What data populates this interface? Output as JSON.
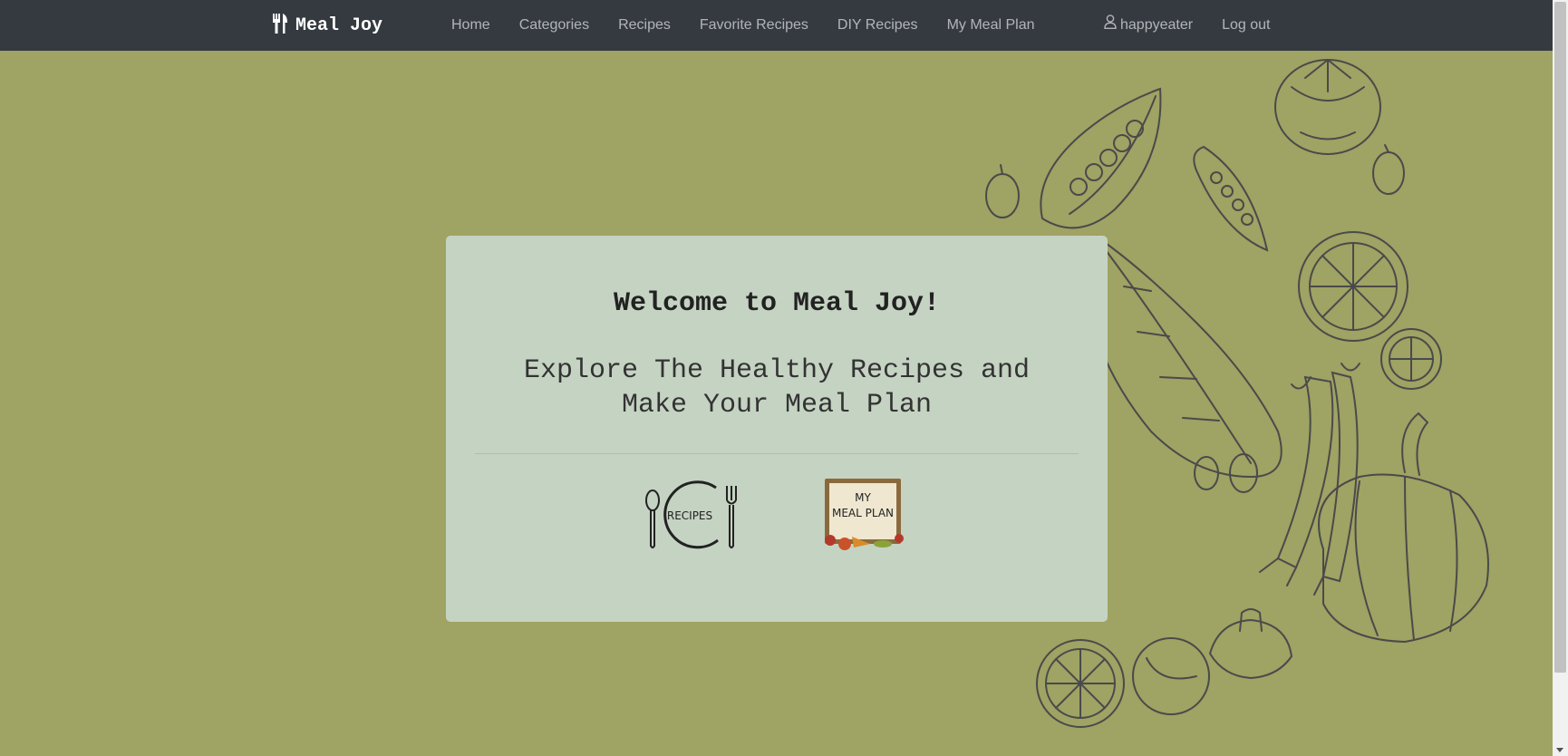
{
  "navbar": {
    "brand": "Meal Joy",
    "links": [
      "Home",
      "Categories",
      "Recipes",
      "Favorite Recipes",
      "DIY Recipes",
      "My Meal Plan"
    ],
    "username": "happyeater",
    "logout": "Log out"
  },
  "card": {
    "title": "Welcome to Meal Joy!",
    "tagline_line1": "Explore The Healthy Recipes and",
    "tagline_line2": "Make Your Meal Plan",
    "recipes_icon_text": "RECIPES",
    "mealplan_line1": "MY",
    "mealplan_line2": "MEAL PLAN"
  },
  "colors": {
    "navbar_bg": "#343a40",
    "page_bg": "#9fa363",
    "card_bg": "#c5d3c2"
  }
}
